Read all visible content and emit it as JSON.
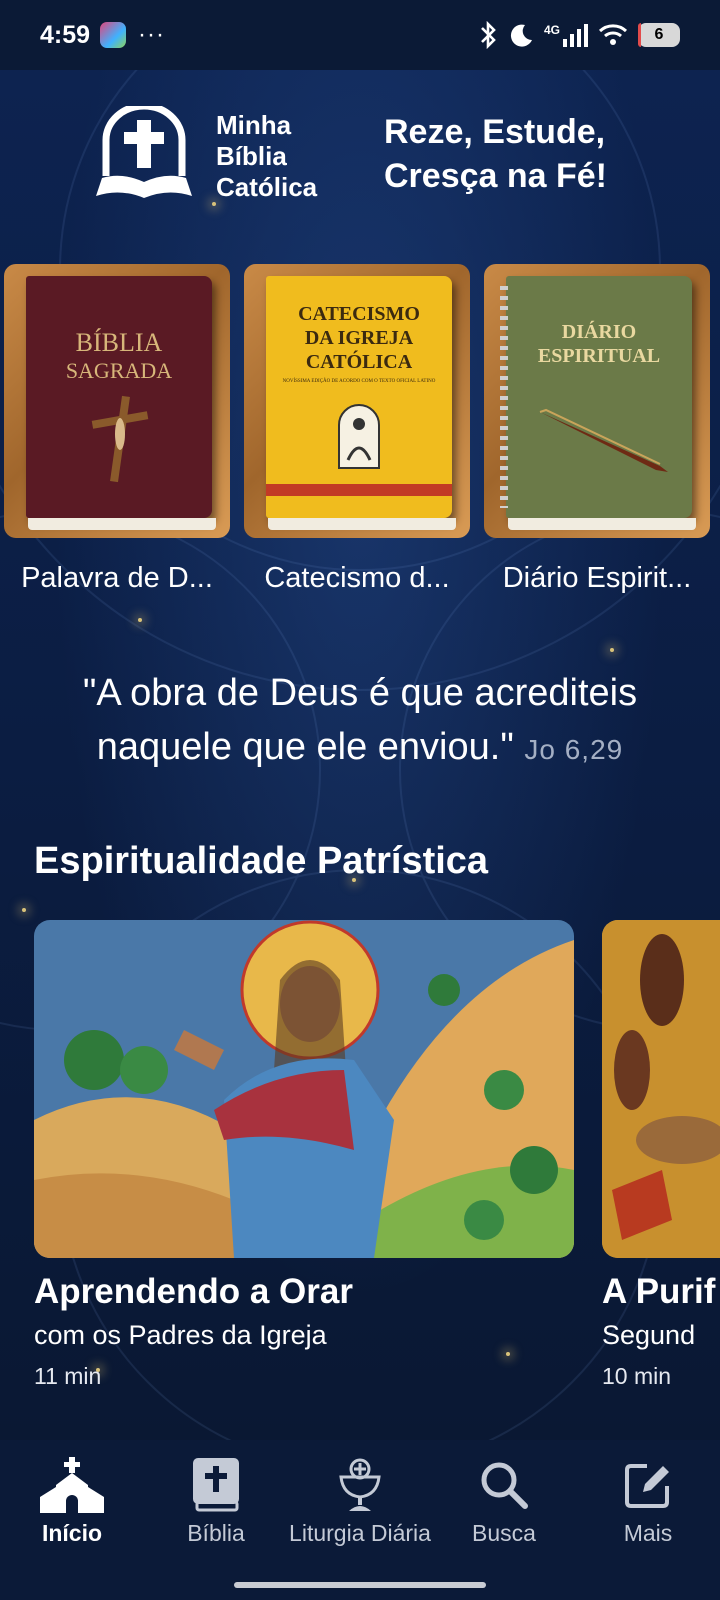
{
  "status_bar": {
    "time": "4:59",
    "more": "···",
    "network": "4G",
    "battery": "6",
    "battery_level_percent": 6
  },
  "header": {
    "logo_lines": [
      "Minha",
      "Bíblia",
      "Católica"
    ],
    "tagline_lines": [
      "Reze, Estude,",
      "Cresça na Fé!"
    ]
  },
  "books": [
    {
      "label": "Palavra de D...",
      "cover_lines": [
        "BÍBLIA",
        "SAGRADA"
      ]
    },
    {
      "label": "Catecismo d...",
      "cover_lines": [
        "CATECISMO",
        "DA IGREJA",
        "CATÓLICA"
      ],
      "cover_small": "NOVÍSSIMA EDIÇÃO DE ACORDO COM O TEXTO OFICIAL LATINO"
    },
    {
      "label": "Diário Espirit...",
      "cover_lines": [
        "DIÁRIO",
        "ESPIRITUAL"
      ]
    }
  ],
  "quote": {
    "text": "\"A obra de Deus é que acrediteis naquele que ele enviou.\"",
    "reference": "Jo 6,29"
  },
  "section": {
    "title": "Espiritualidade Patrística"
  },
  "articles": [
    {
      "title": "Aprendendo a Orar",
      "subtitle": "com os Padres da Igreja",
      "duration": "11 min"
    },
    {
      "title": "A Purif",
      "subtitle": "Segund",
      "duration": "10 min"
    }
  ],
  "nav": {
    "items": [
      {
        "label": "Início",
        "icon": "church-icon",
        "active": true
      },
      {
        "label": "Bíblia",
        "icon": "bible-icon",
        "active": false
      },
      {
        "label": "Liturgia Diária",
        "icon": "chalice-icon",
        "active": false
      },
      {
        "label": "Busca",
        "icon": "search-icon",
        "active": false
      },
      {
        "label": "Mais",
        "icon": "edit-icon",
        "active": false
      }
    ]
  },
  "colors": {
    "background": "#0c1c3b",
    "navbar": "#0b1a38",
    "bible_cover": "#5a1a24",
    "catechism_cover": "#f0bc1e",
    "diary_cover": "#6b7a48",
    "wood": "#b87a3c"
  }
}
